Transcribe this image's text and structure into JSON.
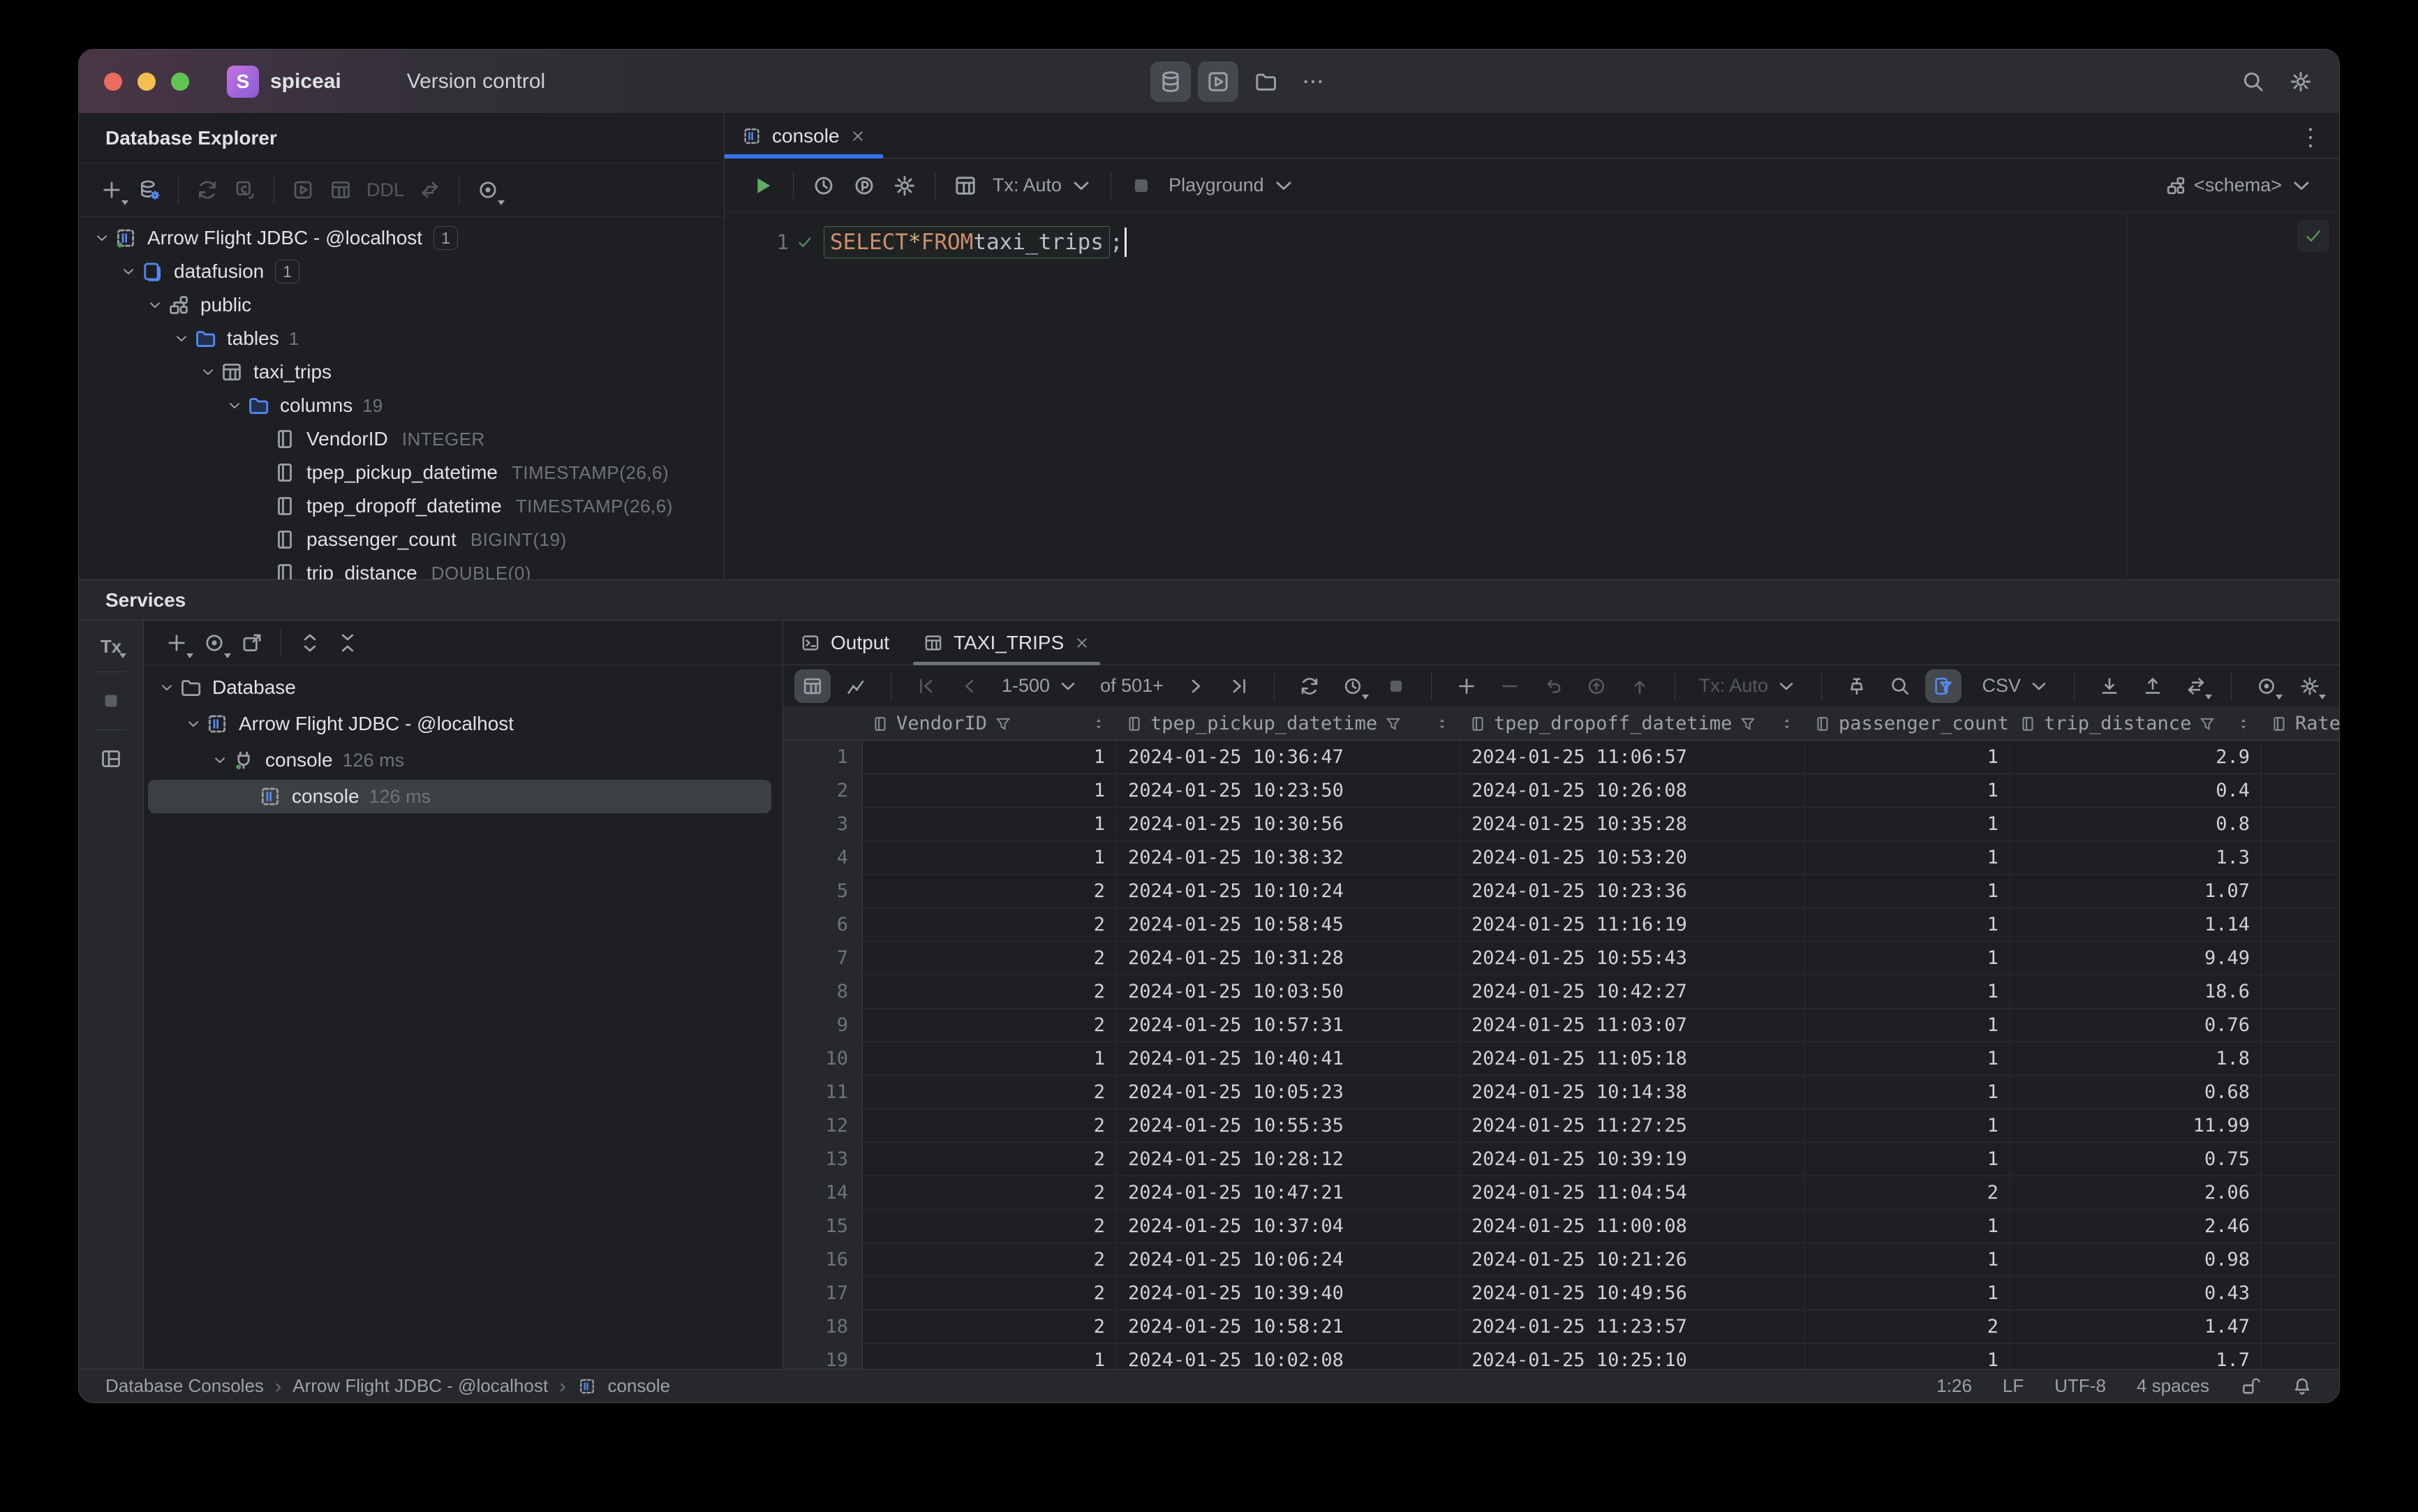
{
  "titlebar": {
    "project": "spiceai",
    "menu": "Version control",
    "quick_icons": [
      {
        "name": "database-tool-button",
        "icon": "database",
        "active": true
      },
      {
        "name": "services-tool-button",
        "icon": "run",
        "active": true
      },
      {
        "name": "project-view-button",
        "icon": "folder"
      },
      {
        "name": "more-tool-windows-button",
        "icon": "more"
      }
    ],
    "right_icons": [
      {
        "name": "search-everywhere-button",
        "icon": "search"
      },
      {
        "name": "settings-button",
        "icon": "gear"
      }
    ]
  },
  "explorer": {
    "title": "Database Explorer",
    "toolbar": [
      {
        "name": "new-item-button",
        "icon": "plus",
        "caret": true
      },
      {
        "name": "datasource-properties-button",
        "icon": "dbgear"
      },
      {
        "divider": true
      },
      {
        "name": "refresh-button",
        "icon": "refresh",
        "disabled": true
      },
      {
        "name": "new-console-button",
        "icon": "newconsole",
        "disabled": true
      },
      {
        "divider": true
      },
      {
        "name": "jump-to-console-button",
        "icon": "playbox",
        "disabled": true
      },
      {
        "name": "open-data-button",
        "icon": "grid",
        "disabled": true
      },
      {
        "name": "ddl-button",
        "label": "DDL",
        "disabled": true
      },
      {
        "name": "navigate-button",
        "icon": "jump",
        "disabled": true
      },
      {
        "divider": true
      },
      {
        "name": "view-options-button",
        "icon": "target",
        "caret": true
      }
    ],
    "tree": [
      {
        "level": 0,
        "chevron": true,
        "icon": "datasourceOn",
        "label": "Arrow Flight JDBC - @localhost",
        "badge": "1"
      },
      {
        "level": 1,
        "chevron": true,
        "icon": "dbblue",
        "label": "datafusion",
        "badge": "1"
      },
      {
        "level": 2,
        "chevron": true,
        "icon": "schema",
        "label": "public"
      },
      {
        "level": 3,
        "chevron": true,
        "icon": "folderblue",
        "label": "tables",
        "count": "1"
      },
      {
        "level": 4,
        "chevron": true,
        "icon": "grid",
        "label": "taxi_trips"
      },
      {
        "level": 5,
        "chevron": true,
        "icon": "folderblue",
        "label": "columns",
        "count": "19"
      },
      {
        "level": 6,
        "chevron": false,
        "icon": "column",
        "label": "VendorID",
        "type": "INTEGER"
      },
      {
        "level": 6,
        "chevron": false,
        "icon": "column",
        "label": "tpep_pickup_datetime",
        "type": "TIMESTAMP(26,6)"
      },
      {
        "level": 6,
        "chevron": false,
        "icon": "column",
        "label": "tpep_dropoff_datetime",
        "type": "TIMESTAMP(26,6)"
      },
      {
        "level": 6,
        "chevron": false,
        "icon": "column",
        "label": "passenger_count",
        "type": "BIGINT(19)"
      },
      {
        "level": 6,
        "chevron": false,
        "icon": "column",
        "label": "trip_distance",
        "type": "DOUBLE(0)"
      }
    ]
  },
  "editor": {
    "tab": {
      "label": "console"
    },
    "toolbar": {
      "tx": "Tx: Auto",
      "playground": "Playground",
      "schema": "<schema>"
    },
    "gutter_line": "1",
    "code": [
      {
        "t": "SELECT",
        "c": "kw"
      },
      {
        "t": " ",
        "c": "pl"
      },
      {
        "t": "*",
        "c": "star"
      },
      {
        "t": " ",
        "c": "pl"
      },
      {
        "t": "FROM",
        "c": "kw"
      },
      {
        "t": " ",
        "c": "pl"
      },
      {
        "t": "taxi_trips",
        "c": "id"
      }
    ],
    "statement_end": ";"
  },
  "services": {
    "title": "Services",
    "strip_tx_label": "Tx",
    "toolbar": [
      {
        "name": "add-service-button",
        "icon": "plus",
        "caret": true
      },
      {
        "name": "view-options-button",
        "icon": "target",
        "caret": true
      },
      {
        "name": "open-each-in-new-tab-button",
        "icon": "opennew"
      },
      {
        "divider": true
      },
      {
        "name": "expand-all-button",
        "icon": "expand"
      },
      {
        "name": "collapse-all-button",
        "icon": "collapse"
      }
    ],
    "tree": [
      {
        "level": 0,
        "chevron": true,
        "icon": "foldergray",
        "label": "Database"
      },
      {
        "level": 1,
        "chevron": true,
        "icon": "datasource",
        "label": "Arrow Flight JDBC - @localhost"
      },
      {
        "level": 2,
        "chevron": true,
        "icon": "connection",
        "label": "console",
        "meta": "126 ms"
      },
      {
        "level": 3,
        "chevron": false,
        "icon": "datasource",
        "label": "console",
        "meta": "126 ms",
        "selected": true
      }
    ]
  },
  "results": {
    "tabs": [
      {
        "name": "tab-output",
        "icon": "terminal",
        "label": "Output"
      },
      {
        "name": "tab-taxi-trips",
        "icon": "grid",
        "label": "TAXI_TRIPS",
        "close": true,
        "active": true
      }
    ],
    "toolbar_left": [
      {
        "name": "table-view-button",
        "icon": "grid",
        "active": true
      },
      {
        "name": "chart-view-button",
        "icon": "chart"
      },
      {
        "divider": true
      },
      {
        "name": "first-page-button",
        "icon": "first",
        "disabled": true
      },
      {
        "name": "previous-page-button",
        "icon": "prev",
        "disabled": true
      },
      {
        "name": "page-size-dropdown",
        "label": "1-500",
        "caret": true
      },
      {
        "name": "total-count-label",
        "label": "of 501+"
      },
      {
        "name": "next-page-button",
        "icon": "next"
      },
      {
        "name": "last-page-button",
        "icon": "last"
      },
      {
        "divider": true
      },
      {
        "name": "reload-page-button",
        "icon": "refresh"
      },
      {
        "name": "execution-time-button",
        "icon": "clock",
        "caret": true
      },
      {
        "name": "stop-button",
        "icon": "stop",
        "disabled": true
      },
      {
        "divider": true
      },
      {
        "name": "add-row-button",
        "icon": "plus"
      },
      {
        "name": "delete-row-button",
        "icon": "minus",
        "disabled": true
      },
      {
        "name": "revert-button",
        "icon": "undo",
        "disabled": true
      },
      {
        "name": "submit-button",
        "icon": "resolve",
        "disabled": true
      },
      {
        "name": "commit-button",
        "icon": "push",
        "disabled": true
      },
      {
        "divider": true
      },
      {
        "name": "tx-mode-dropdown",
        "label": "Tx: Auto",
        "caret": true,
        "disabled": true
      },
      {
        "divider": true
      },
      {
        "name": "pin-tab-button",
        "icon": "pin"
      },
      {
        "name": "find-button",
        "icon": "search"
      },
      {
        "name": "filter-panel-button",
        "icon": "funnelpanel",
        "active": true,
        "blue": true
      }
    ],
    "toolbar_right": [
      {
        "name": "export-format-dropdown",
        "label": "CSV",
        "caret": true
      },
      {
        "divider": true
      },
      {
        "name": "import-button",
        "icon": "download"
      },
      {
        "name": "export-button",
        "icon": "upload"
      },
      {
        "name": "transfer-button",
        "icon": "exportarrows",
        "caret": true
      },
      {
        "divider": true
      },
      {
        "name": "view-options-button",
        "icon": "target",
        "caret": true
      },
      {
        "name": "grid-settings-button",
        "icon": "gear",
        "caret": true
      }
    ],
    "columns": [
      {
        "label": "VendorID"
      },
      {
        "label": "tpep_pickup_datetime"
      },
      {
        "label": "tpep_dropoff_datetime"
      },
      {
        "label": "passenger_count"
      },
      {
        "label": "trip_distance"
      },
      {
        "label": "Rate",
        "partial": true
      }
    ],
    "rows": [
      [
        "1",
        "2024-01-25 10:36:47",
        "2024-01-25 11:06:57",
        "1",
        "2.9"
      ],
      [
        "1",
        "2024-01-25 10:23:50",
        "2024-01-25 10:26:08",
        "1",
        "0.4"
      ],
      [
        "1",
        "2024-01-25 10:30:56",
        "2024-01-25 10:35:28",
        "1",
        "0.8"
      ],
      [
        "1",
        "2024-01-25 10:38:32",
        "2024-01-25 10:53:20",
        "1",
        "1.3"
      ],
      [
        "2",
        "2024-01-25 10:10:24",
        "2024-01-25 10:23:36",
        "1",
        "1.07"
      ],
      [
        "2",
        "2024-01-25 10:58:45",
        "2024-01-25 11:16:19",
        "1",
        "1.14"
      ],
      [
        "2",
        "2024-01-25 10:31:28",
        "2024-01-25 10:55:43",
        "1",
        "9.49"
      ],
      [
        "2",
        "2024-01-25 10:03:50",
        "2024-01-25 10:42:27",
        "1",
        "18.6"
      ],
      [
        "2",
        "2024-01-25 10:57:31",
        "2024-01-25 11:03:07",
        "1",
        "0.76"
      ],
      [
        "1",
        "2024-01-25 10:40:41",
        "2024-01-25 11:05:18",
        "1",
        "1.8"
      ],
      [
        "2",
        "2024-01-25 10:05:23",
        "2024-01-25 10:14:38",
        "1",
        "0.68"
      ],
      [
        "2",
        "2024-01-25 10:55:35",
        "2024-01-25 11:27:25",
        "1",
        "11.99"
      ],
      [
        "2",
        "2024-01-25 10:28:12",
        "2024-01-25 10:39:19",
        "1",
        "0.75"
      ],
      [
        "2",
        "2024-01-25 10:47:21",
        "2024-01-25 11:04:54",
        "2",
        "2.06"
      ],
      [
        "2",
        "2024-01-25 10:37:04",
        "2024-01-25 11:00:08",
        "1",
        "2.46"
      ],
      [
        "2",
        "2024-01-25 10:06:24",
        "2024-01-25 10:21:26",
        "1",
        "0.98"
      ],
      [
        "2",
        "2024-01-25 10:39:40",
        "2024-01-25 10:49:56",
        "1",
        "0.43"
      ],
      [
        "2",
        "2024-01-25 10:58:21",
        "2024-01-25 11:23:57",
        "2",
        "1.47"
      ],
      [
        "1",
        "2024-01-25 10:02:08",
        "2024-01-25 10:25:10",
        "1",
        "1.7"
      ]
    ]
  },
  "statusbar": {
    "breadcrumbs": [
      "Database Consoles",
      "Arrow Flight JDBC - @localhost",
      "console"
    ],
    "items": [
      "1:26",
      "LF",
      "UTF-8",
      "4 spaces"
    ]
  }
}
